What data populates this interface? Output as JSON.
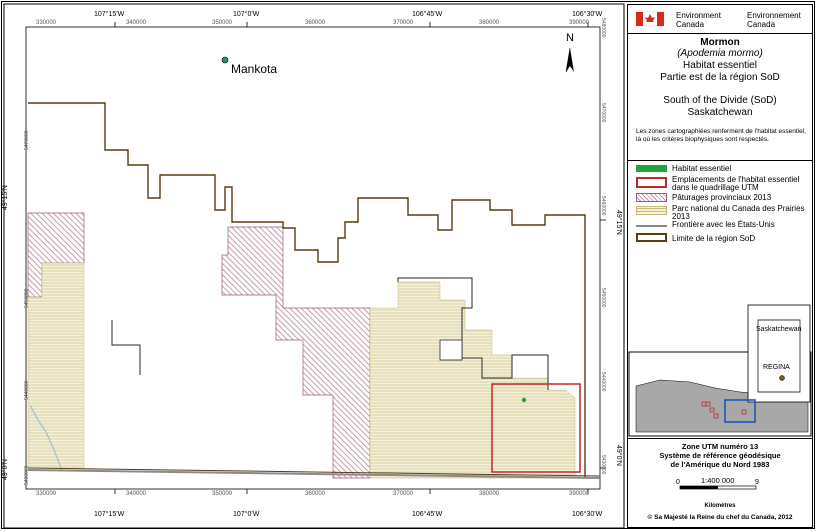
{
  "colors": {
    "boundary": "#5a3c14",
    "park_fill": "#f4f0da",
    "park_hatch": "#c9b97a",
    "pasture_hatch": "#a05a7a",
    "habitat_cell": "#c0282a",
    "border": "#8a8a8a",
    "habitat": "#21a53b",
    "water": "#9ac4d8"
  },
  "map": {
    "top_lon_labels": [
      "107°15'W",
      "107°0'W",
      "106°45'W",
      "106°30'W"
    ],
    "bottom_lon_labels": [
      "107°15'W",
      "107°0'W",
      "106°45'W",
      "106°30'W"
    ],
    "top_easting_labels": [
      "330000",
      "340000",
      "350000",
      "360000",
      "370000",
      "380000",
      "390000"
    ],
    "bottom_easting_labels": [
      "330000",
      "340000",
      "350000",
      "360000",
      "370000",
      "380000",
      "390000"
    ],
    "lat_labels": [
      "49°15'N",
      "49°0'N"
    ],
    "northing_labels": [
      "5470000",
      "5460000",
      "5450000",
      "5440000",
      "5430000",
      "5480000"
    ],
    "town": "Mankota",
    "north_arrow": "N"
  },
  "header": {
    "agency_en": "Environment\nCanada",
    "agency_fr": "Environnement\nCanada"
  },
  "title": {
    "species_common": "Mormon",
    "species_latin": "(Apodemia mormo)",
    "line3": "Habitat essentiel",
    "line4": "Partie est de la région SoD",
    "region1": "South of the Divide (SoD)",
    "region2": "Saskatchewan",
    "note": "Les zones cartographiées renferment de l'habitat essentiel, là où les critères biophysiques sont respectés."
  },
  "legend": [
    {
      "key": "habitat",
      "label": "Habitat essentiel"
    },
    {
      "key": "grid",
      "label": "Emplacements de l'habitat essentiel\ndans le quadrillage UTM"
    },
    {
      "key": "pasture",
      "label": "Pâturages provinciaux 2013"
    },
    {
      "key": "park",
      "label": "Parc national du Canada des Prairies\n2013"
    },
    {
      "key": "border",
      "label": "Frontière avec les États-Unis"
    },
    {
      "key": "sod",
      "label": "Limite de la région SoD"
    }
  ],
  "inset": {
    "province": "Saskatchewan",
    "city": "REGINA"
  },
  "info": {
    "zone": "Zone UTM numéro 13",
    "datum1": "Système de référence géodésique",
    "datum2": "de l'Amérique du Nord 1983",
    "scale": "1:400 000",
    "scale_min": "0",
    "scale_max": "9",
    "scale_unit": "Kilomètres",
    "copyright": "© Sa Majesté la Reine du chef du Canada, 2012"
  }
}
